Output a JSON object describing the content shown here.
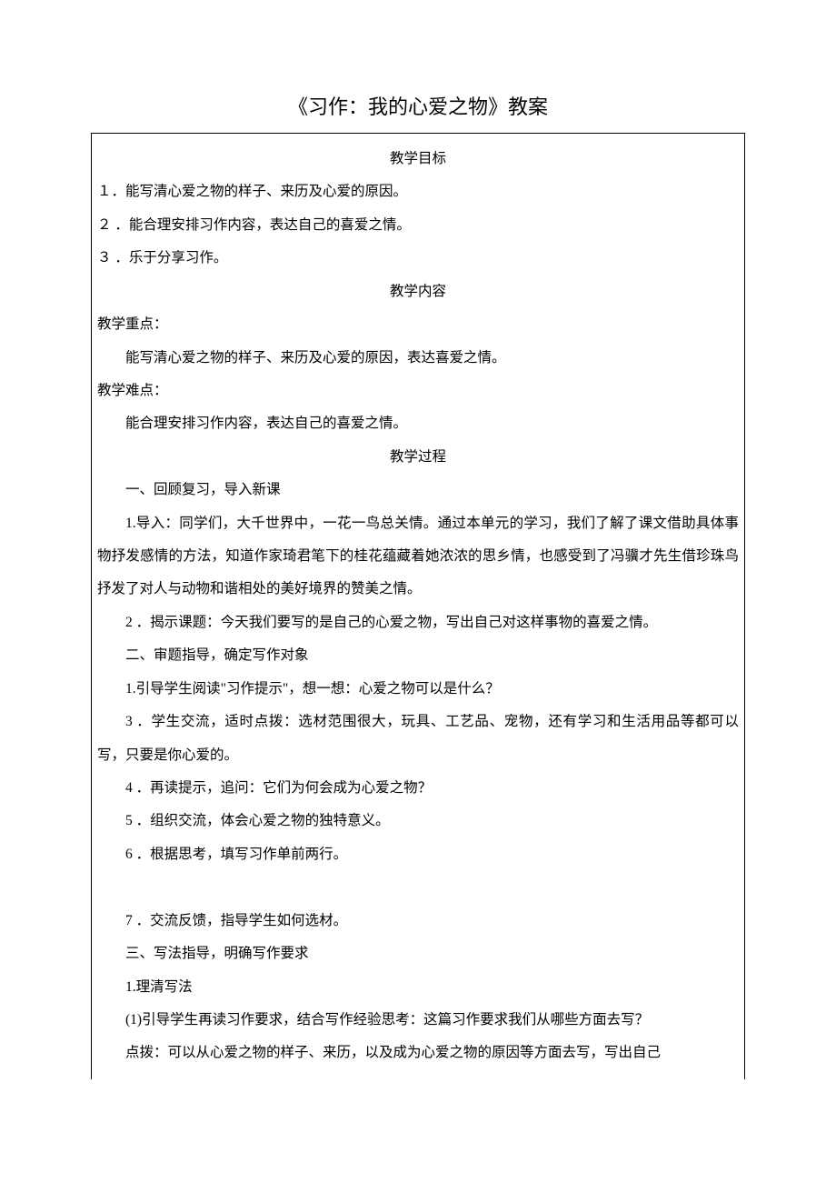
{
  "title": "《习作：我的心爱之物》教案",
  "sec1_heading": "教学目标",
  "goal1": "１．能写清心爱之物的样子、来历及心爱的原因。",
  "goal2": "２ ．能合理安排习作内容，表达自己的喜爱之情。",
  "goal3": "３ ．乐于分享习作。",
  "sec2_heading": "教学内容",
  "keypoint_label": "教学重点：",
  "keypoint_text": "能写清心爱之物的样子、来历及心爱的原因，表达喜爱之情。",
  "difficulty_label": "教学难点：",
  "difficulty_text": "能合理安排习作内容，表达自己的喜爱之情。",
  "sec3_heading": "教学过程",
  "part1_heading": "一、回顾复习，导入新课",
  "part1_item1": "1.导入：同学们，大千世界中，一花一鸟总关情。通过本单元的学习，我们了解了课文借助具体事物抒发感情的方法，知道作家琦君笔下的桂花蕴藏着她浓浓的思乡情，也感受到了冯骥才先生借珍珠鸟抒发了对人与动物和谐相处的美好境界的赞美之情。",
  "part1_item2": "2 ．揭示课题：今天我们要写的是自己的心爱之物，写出自己对这样事物的喜爱之情。",
  "part2_heading": "二、审题指导，确定写作对象",
  "part2_item1": "1.引导学生阅读\"习作提示\"，想一想：心爱之物可以是什么？",
  "part2_item3": "3 ．学生交流，适时点拨：选材范围很大，玩具、工艺品、宠物，还有学习和生活用品等都可以写，只要是你心爱的。",
  "part2_item4": "4 ．再读提示，追问：它们为何会成为心爱之物？",
  "part2_item5": "5 ．组织交流，体会心爱之物的独特意义。",
  "part2_item6": "6 ．根据思考，填写习作单前两行。",
  "part2_item7": "7 ．交流反馈，指导学生如何选材。",
  "part3_heading": "三、写法指导，明确写作要求",
  "part3_item1": "1.理清写法",
  "part3_sub1": "(1)引导学生再读习作要求，结合写作经验思考：这篇习作要求我们从哪些方面去写？",
  "part3_tip": "点拨：可以从心爱之物的样子、来历，以及成为心爱之物的原因等方面去写，写出自己"
}
